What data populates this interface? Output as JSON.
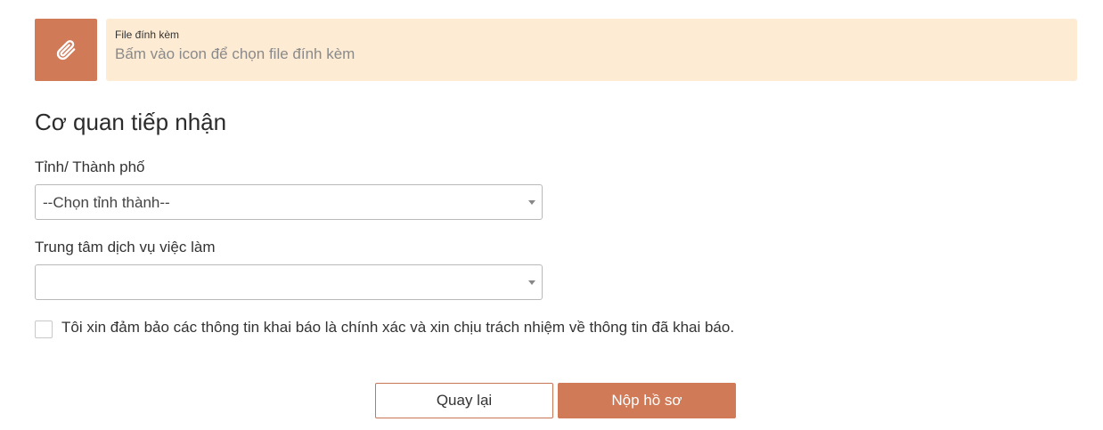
{
  "attachment": {
    "icon": "paperclip-icon",
    "label": "File đính kèm",
    "placeholder": "Bấm vào icon để chọn file đính kèm"
  },
  "receiving_agency": {
    "title": "Cơ quan tiếp nhận",
    "province": {
      "label": "Tỉnh/ Thành phố",
      "selected": "--Chọn tỉnh thành--"
    },
    "employment_center": {
      "label": "Trung tâm dịch vụ việc làm",
      "selected": ""
    }
  },
  "agreement": {
    "checked": false,
    "text": "Tôi xin đảm bảo các thông tin khai báo là chính xác và xin chịu trách nhiệm về thông tin đã khai báo."
  },
  "actions": {
    "back_label": "Quay lại",
    "submit_label": "Nộp hồ sơ"
  },
  "colors": {
    "accent": "#d07a58",
    "attachment_bg": "#fdebd3",
    "border": "#b9b9b9"
  }
}
